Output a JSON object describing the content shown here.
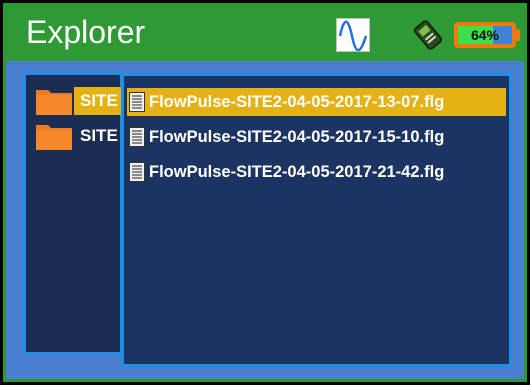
{
  "window": {
    "title": "Explorer"
  },
  "status": {
    "battery_percent_label": "64%",
    "battery_level": 0.64,
    "signal_icon": "sine-wave-icon",
    "device_icon": "flow-meter-device-icon"
  },
  "folders": [
    {
      "label": "SITE",
      "selected": true
    },
    {
      "label": "SITE",
      "selected": false
    }
  ],
  "files": [
    {
      "name": "FlowPulse-SITE2-04-05-2017-13-07.flg",
      "selected": true
    },
    {
      "name": "FlowPulse-SITE2-04-05-2017-15-10.flg",
      "selected": false
    },
    {
      "name": "FlowPulse-SITE2-04-05-2017-21-42.flg",
      "selected": false
    }
  ],
  "colors": {
    "title_bar": "#2f9936",
    "selection": "#e4b214",
    "panel_border": "#1f8fe6",
    "battery_frame": "#f07a10",
    "battery_fill": "#3be04a"
  }
}
